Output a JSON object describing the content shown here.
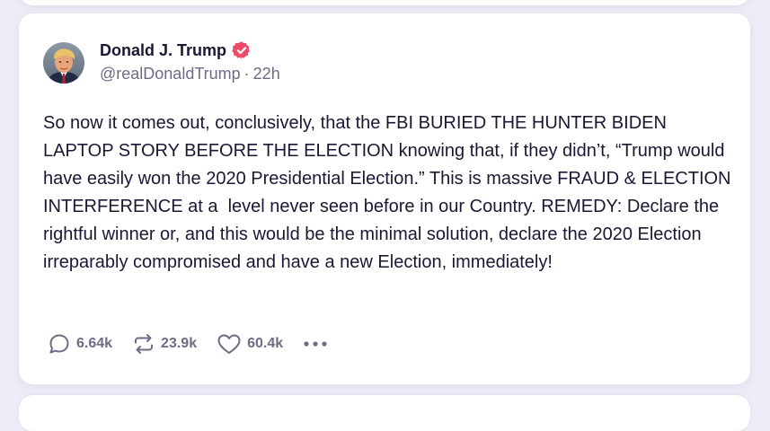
{
  "post": {
    "author": {
      "display_name": "Donald J. Trump",
      "handle": "@realDonaldTrump",
      "verified": true,
      "avatar_icon": "user-portrait"
    },
    "separator": "·",
    "time_ago": "22h",
    "body": "So now it comes out, conclusively, that the FBI BURIED THE HUNTER BIDEN LAPTOP STORY BEFORE THE ELECTION knowing that, if they didn’t, “Trump would have easily won the 2020 Presidential Election.” This is massive FRAUD & ELECTION INTERFERENCE at a  level never seen before in our Country. REMEDY: Declare the rightful winner or, and this would be the minimal solution, declare the 2020 Election irreparably compromised and have a new Election, immediately!",
    "actions": {
      "replies": "6.64k",
      "reposts": "23.9k",
      "likes": "60.4k",
      "more_icon": "more-horizontal"
    }
  },
  "colors": {
    "background": "#eeedf7",
    "card": "#ffffff",
    "text_primary": "#1b1734",
    "text_secondary": "#6e6b84",
    "verified_badge": "#ee4b6a"
  }
}
